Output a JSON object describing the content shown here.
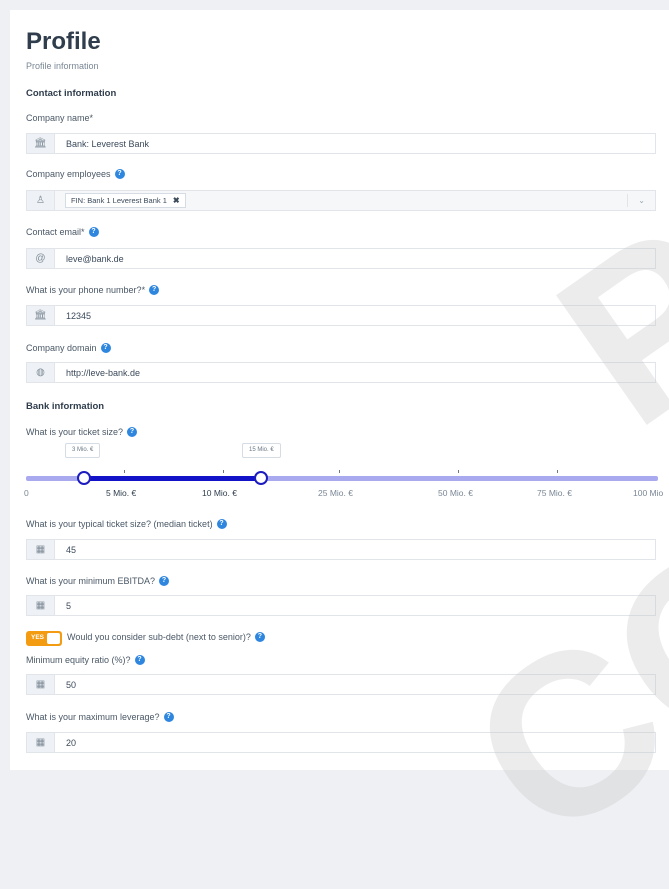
{
  "page": {
    "title": "Profile",
    "subtitle": "Profile information",
    "watermark_p": "P",
    "watermark_co": "CO"
  },
  "contact_section": {
    "heading": "Contact information",
    "company_name": {
      "label": "Company name*",
      "value": "Bank: Leverest Bank",
      "icon": "bank-icon"
    },
    "company_employees": {
      "label": "Company employees",
      "tag": "FIN: Bank 1 Leverest Bank 1",
      "tag_remove": "✖",
      "icon": "user-icon"
    },
    "contact_email": {
      "label": "Contact email*",
      "value": "leve@bank.de",
      "icon": "at-icon"
    },
    "phone": {
      "label": "What is your phone number?*",
      "value": "12345",
      "icon": "bank-icon"
    },
    "domain": {
      "label": "Company domain",
      "value": "http://leve-bank.de",
      "icon": "globe-icon"
    }
  },
  "bank_section": {
    "heading": "Bank information",
    "ticket_size": {
      "label": "What is your ticket size?",
      "min_bubble": "3 Mio. €",
      "max_bubble": "15 Mio. €",
      "range_fraction": [
        0.092,
        0.372
      ],
      "ticks": [
        {
          "label": "0",
          "major": false
        },
        {
          "label": "5 Mio. €",
          "major": true
        },
        {
          "label": "10 Mio. €",
          "major": true
        },
        {
          "label": "25 Mio. €",
          "major": false
        },
        {
          "label": "50 Mio. €",
          "major": false
        },
        {
          "label": "75 Mio. €",
          "major": false
        },
        {
          "label": "100 Mio",
          "major": false
        }
      ]
    },
    "typical_ticket": {
      "label": "What is your typical ticket size? (median ticket)",
      "value": "45",
      "icon": "calculator-icon"
    },
    "min_ebitda": {
      "label": "What is your minimum EBITDA?",
      "value": "5",
      "icon": "calculator-icon"
    },
    "sub_debt": {
      "toggle": "YES",
      "label": "Would you consider sub-debt (next to senior)?",
      "checked": true
    },
    "equity_ratio": {
      "label": "Minimum equity ratio (%)?",
      "value": "50",
      "icon": "calculator-icon"
    },
    "max_leverage": {
      "label": "What is your maximum leverage?",
      "value": "20",
      "icon": "calculator-icon"
    }
  },
  "help_glyph": "?",
  "icons": {
    "bank": "🏛",
    "user": "♙",
    "at": "@",
    "globe": "◍",
    "calculator": "▦",
    "chevron": "⌄"
  }
}
